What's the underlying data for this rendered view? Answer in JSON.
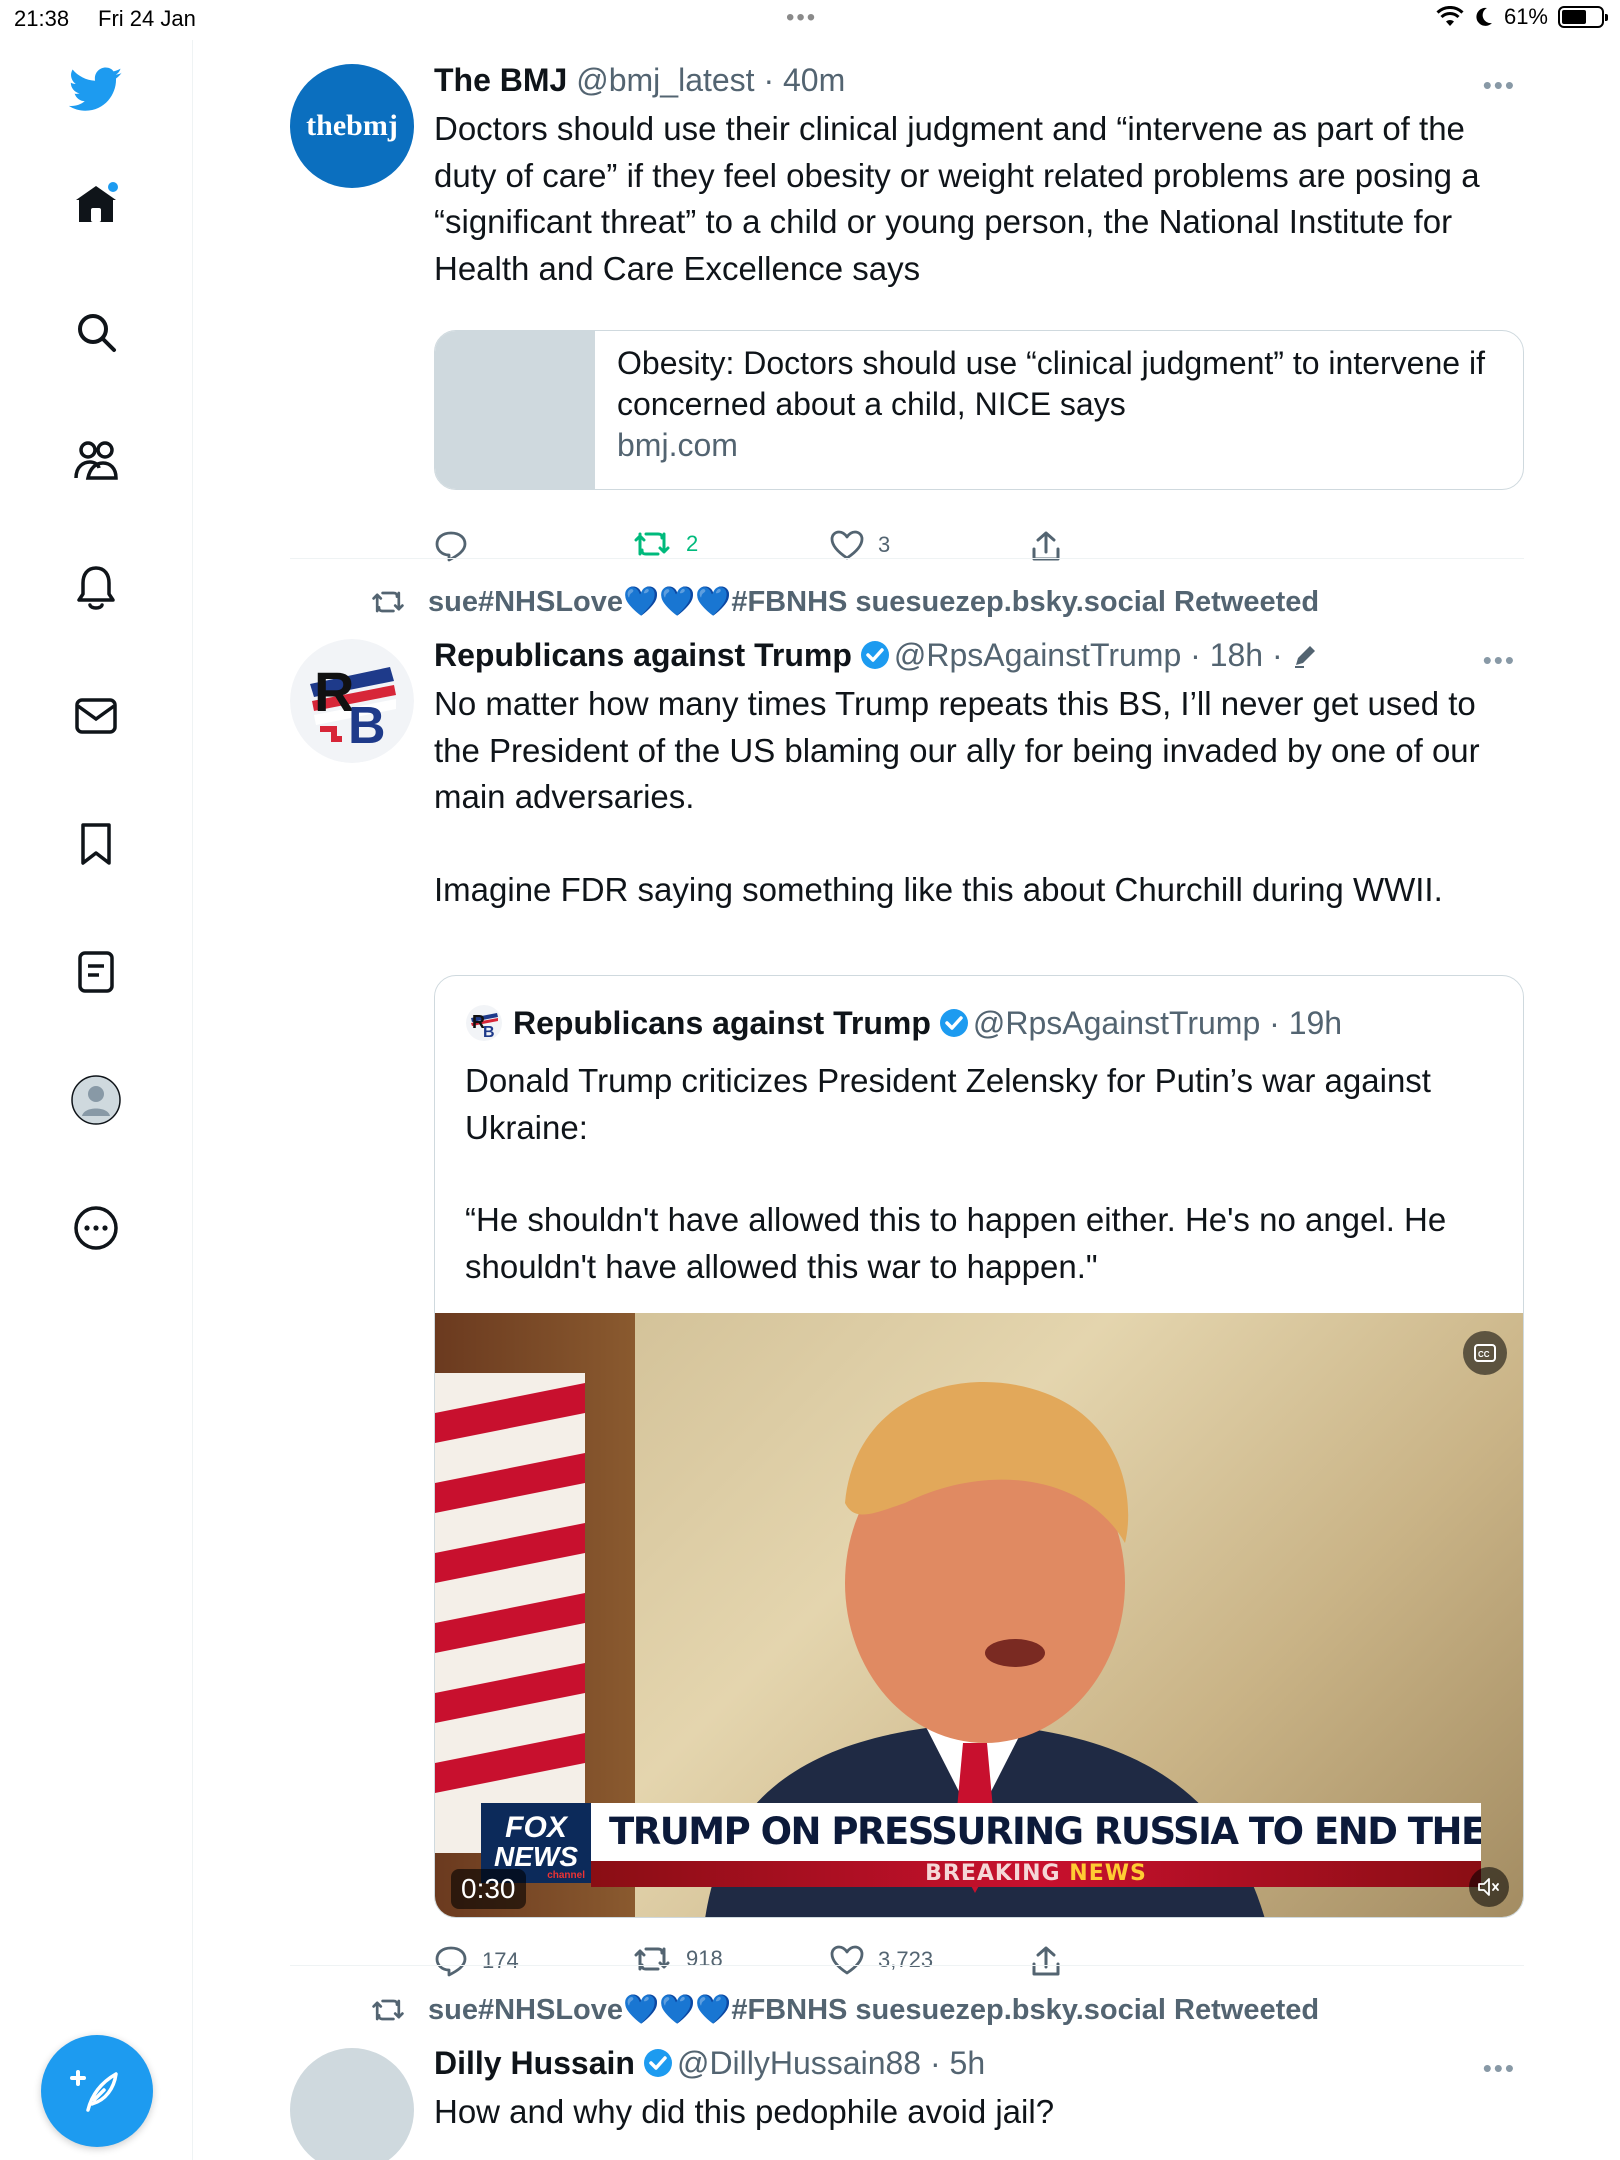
{
  "status_bar": {
    "time": "21:38",
    "date": "Fri 24 Jan",
    "battery": "61%"
  },
  "sidebar": {
    "items": [
      {
        "icon": "twitter-bird-icon"
      },
      {
        "icon": "home-icon"
      },
      {
        "icon": "search-icon"
      },
      {
        "icon": "communities-icon"
      },
      {
        "icon": "notifications-bell-icon"
      },
      {
        "icon": "messages-envelope-icon"
      },
      {
        "icon": "bookmark-icon"
      },
      {
        "icon": "lists-icon"
      },
      {
        "icon": "profile-avatar-icon"
      },
      {
        "icon": "more-circle-icon"
      }
    ],
    "compose_icon": "compose-tweet-icon"
  },
  "tweets": [
    {
      "name": "The BMJ",
      "handle": "@bmj_latest",
      "time": "40m",
      "avatar_text": "thebmj",
      "text": "Doctors should use their clinical judgment and “intervene as part of the duty of care” if they feel obesity or weight related problems are posing a “significant threat” to a child or young person, the National Institute for Health and Care Excellence says",
      "link_card": {
        "title": "Obesity: Doctors should use “clinical judgment” to intervene if concerned about a child, NICE says",
        "domain": "bmj.com"
      },
      "replies": "",
      "retweets": "2",
      "likes": "3"
    },
    {
      "retweeted_by": "sue#NHSLove💙💙💙#FBNHS suesuezep.bsky.social Retweeted",
      "name": "Republicans against Trump",
      "handle": "@RpsAgainstTrump",
      "time": "18h",
      "avatar_text": "RB",
      "text_p1": "No matter how many times Trump repeats this BS, I’ll never get used to the President of the US blaming our ally for being invaded by one of our main adversaries.",
      "text_p2": "Imagine FDR saying something like this about Churchill during WWII.",
      "quote": {
        "name": "Republicans against Trump",
        "handle": "@RpsAgainstTrump",
        "time": "19h",
        "text_p1": "Donald Trump criticizes President Zelensky for Putin’s war against Ukraine:",
        "text_p2": "“He shouldn't have allowed this to happen either. He's no angel. He shouldn't have allowed this war to happen.\"",
        "video": {
          "headline": "TRUMP ON PRESSURING RUSSIA TO END THE WAR",
          "banner": "BREAKING",
          "banner_accent": "NEWS",
          "logo_top": "FOX",
          "logo_bottom": "NEWS",
          "logo_sub": "channel",
          "duration": "0:30"
        }
      },
      "replies": "174",
      "retweets": "918",
      "likes": "3,723"
    },
    {
      "retweeted_by": "sue#NHSLove💙💙💙#FBNHS suesuezep.bsky.social Retweeted",
      "name": "Dilly Hussain",
      "handle": "@DillyHussain88",
      "time": "5h",
      "text": "How and why did this pedophile avoid jail?"
    }
  ],
  "colors": {
    "accent": "#1d9bf0",
    "retweet_green": "#00ba7c",
    "text_secondary": "#536471",
    "bmj_blue": "#0b6fbf"
  }
}
